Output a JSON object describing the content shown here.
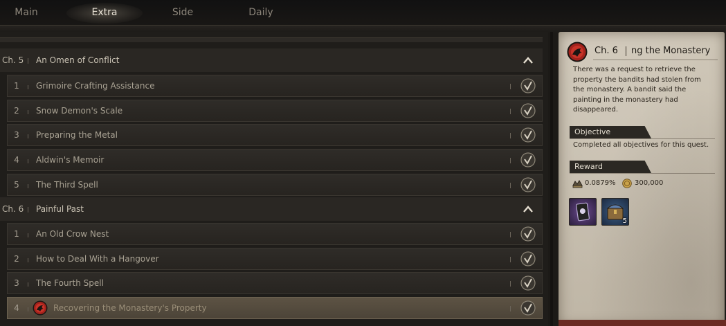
{
  "tabs": [
    {
      "label": "Main"
    },
    {
      "label": "Extra"
    },
    {
      "label": "Side"
    },
    {
      "label": "Daily"
    }
  ],
  "active_tab": "Extra",
  "chapters": [
    {
      "number": "Ch. 5",
      "title": "An Omen of Conflict",
      "quests": [
        {
          "number": "1",
          "title": "Grimoire Crafting Assistance"
        },
        {
          "number": "2",
          "title": "Snow Demon's Scale"
        },
        {
          "number": "3",
          "title": "Preparing the Metal"
        },
        {
          "number": "4",
          "title": "Aldwin's Memoir"
        },
        {
          "number": "5",
          "title": "The Third Spell"
        }
      ]
    },
    {
      "number": "Ch. 6",
      "title": "Painful Past",
      "quests": [
        {
          "number": "1",
          "title": "An Old Crow Nest"
        },
        {
          "number": "2",
          "title": "How to Deal With a Hangover"
        },
        {
          "number": "3",
          "title": "The Fourth Spell"
        },
        {
          "number": "4",
          "title": "Recovering the Monastery's Property"
        }
      ]
    }
  ],
  "detail": {
    "chapter": "Ch. 6",
    "title": "ng the Monastery",
    "description": "There was a request to retrieve the property the bandits had stolen from the monastery. A bandit said the painting in the monastery had disappeared.",
    "objective_label": "Objective",
    "objective_text": "Completed all objectives for this quest.",
    "reward_label": "Reward",
    "rewards": [
      {
        "icon": "exp-icon",
        "value": "0.0879%"
      },
      {
        "icon": "gold-coin-icon",
        "value": "300,000"
      }
    ],
    "items": [
      {
        "icon": "card-item-icon",
        "count": ""
      },
      {
        "icon": "treasure-chest-icon",
        "count": "5"
      }
    ]
  },
  "colors": {
    "background": "#1f1d1a",
    "selected_row": "#5d5344",
    "parchment": "#cfc7b8",
    "quest_icon_red": "#a3221c"
  }
}
